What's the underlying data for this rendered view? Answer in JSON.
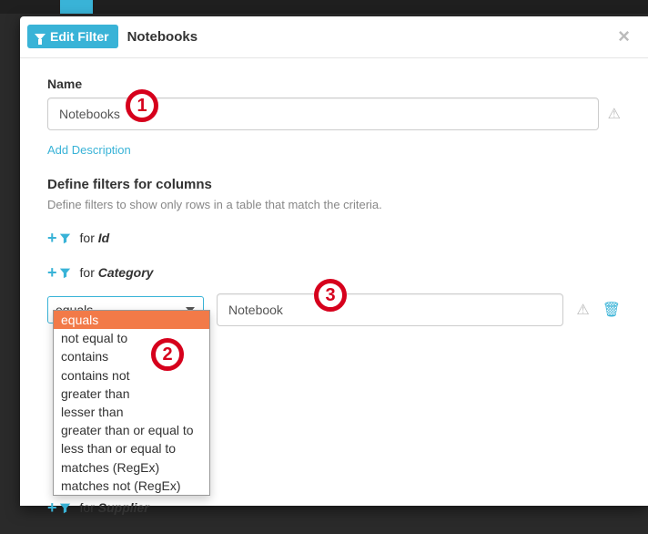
{
  "header": {
    "badge_label": "Edit Filter",
    "context": "Notebooks"
  },
  "form": {
    "name_label": "Name",
    "name_value": "Notebooks",
    "add_description": "Add Description"
  },
  "filters_section": {
    "heading": "Define filters for columns",
    "subheading": "Define filters to show only rows in a table that match the criteria.",
    "for_word": "for",
    "columns": {
      "id": "Id",
      "category": "Category",
      "supplier": "Supplier"
    }
  },
  "condition": {
    "selected_operator": "equals",
    "value": "Notebook",
    "operator_options": [
      "equals",
      "not equal to",
      "contains",
      "contains not",
      "greater than",
      "lesser than",
      "greater than or equal to",
      "less than or equal to",
      "matches (RegEx)",
      "matches not (RegEx)"
    ]
  },
  "annotations": {
    "a1": "1",
    "a2": "2",
    "a3": "3"
  }
}
